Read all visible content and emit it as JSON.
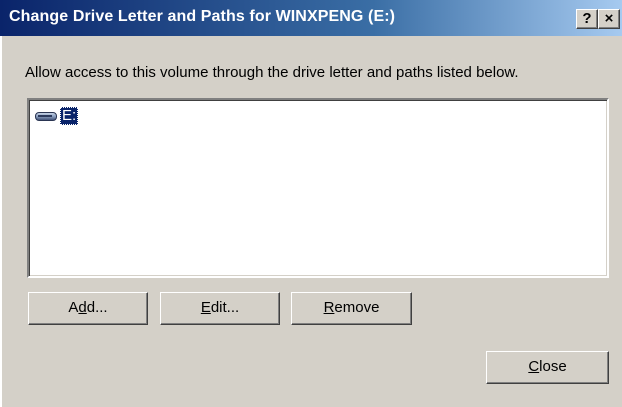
{
  "window": {
    "title": "Change Drive Letter and Paths for WINXPENG (E:)",
    "help_label": "?",
    "close_label": "×"
  },
  "description": "Allow access to this volume through the drive letter and paths listed below.",
  "list": {
    "items": [
      {
        "label": "E:",
        "icon": "drive-icon",
        "selected": true
      }
    ]
  },
  "buttons": {
    "add": {
      "pre": "A",
      "mn": "d",
      "post": "d..."
    },
    "edit": {
      "pre": "",
      "mn": "E",
      "post": "dit..."
    },
    "remove": {
      "pre": "",
      "mn": "R",
      "post": "emove"
    },
    "close": {
      "pre": "",
      "mn": "C",
      "post": "lose"
    }
  },
  "colors": {
    "titlebar_start": "#0a246a",
    "titlebar_end": "#a6caf0",
    "face": "#d4d0c8",
    "selection": "#0a246a"
  }
}
